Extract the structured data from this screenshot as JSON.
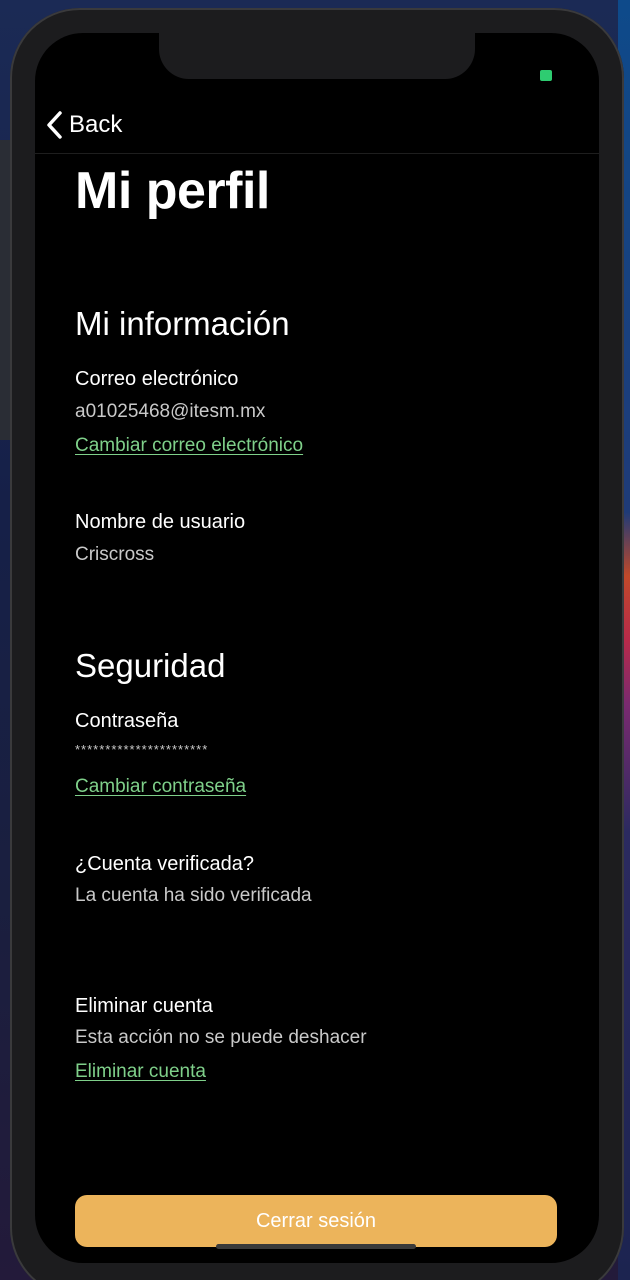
{
  "colors": {
    "background": "#000000",
    "text": "#ffffff",
    "secondary_text": "#c9c9c9",
    "link": "#7fd08a",
    "primary_button": "#ecb45b",
    "status_indicator": "#2ecc71"
  },
  "navbar": {
    "back_label": "Back",
    "back_icon": "chevron-left-icon"
  },
  "page": {
    "title": "Mi perfil"
  },
  "info_section": {
    "title": "Mi información",
    "email_label": "Correo electrónico",
    "email_value": "a01025468@itesm.mx",
    "change_email_link": "Cambiar correo electrónico",
    "username_label": "Nombre de usuario",
    "username_value": "Criscross"
  },
  "security_section": {
    "title": "Seguridad",
    "password_label": "Contraseña",
    "password_value": "**********************",
    "change_password_link": "Cambiar contraseña",
    "verified_label": "¿Cuenta verificada?",
    "verified_value": "La cuenta ha sido verificada",
    "delete_label": "Eliminar cuenta",
    "delete_description": "Esta acción no se puede deshacer",
    "delete_link": "Eliminar cuenta"
  },
  "logout_button": "Cerrar sesión"
}
